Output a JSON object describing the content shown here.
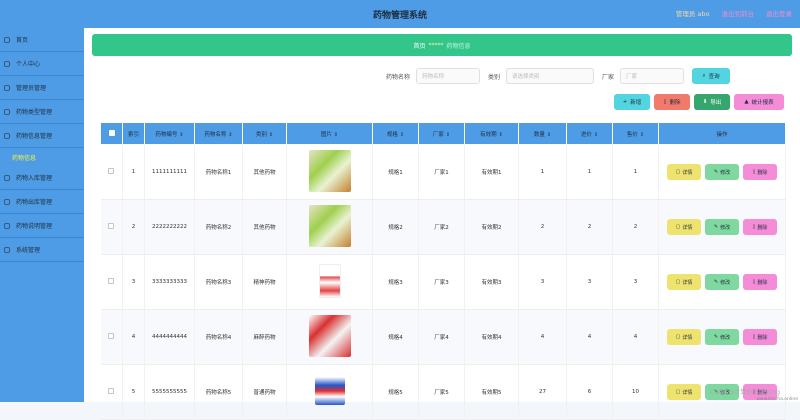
{
  "header": {
    "title": "药物管理系统",
    "admin": "管理员 abo",
    "exit_label": "退出到前台",
    "logout_label": "退出登录"
  },
  "sidebar": {
    "items": [
      {
        "label": "首页"
      },
      {
        "label": "个人中心"
      },
      {
        "label": "管理员管理"
      },
      {
        "label": "药物类型管理"
      },
      {
        "label": "药物信息管理"
      },
      {
        "label": "药物信息",
        "sub": true
      },
      {
        "label": "药物入库管理"
      },
      {
        "label": "药物出库管理"
      },
      {
        "label": "药物说明管理"
      },
      {
        "label": "系统管理"
      }
    ]
  },
  "breadcrumb": {
    "home": "首页",
    "sep": "*****",
    "current": "药物信息"
  },
  "filters": {
    "name_label": "药物名称",
    "name_placeholder": "药物名称",
    "type_label": "类别",
    "type_placeholder": "请选择类别",
    "maker_label": "厂家",
    "maker_placeholder": "厂家",
    "search_label": "查询"
  },
  "toolbar": {
    "add": "新增",
    "delete": "删除",
    "export": "导出",
    "stats": "统计报表"
  },
  "table": {
    "headers": [
      "索引",
      "药物编号",
      "药物名称",
      "类别",
      "图片",
      "规格",
      "厂家",
      "有效期",
      "数量",
      "进价",
      "售价",
      "操作"
    ],
    "rows": [
      {
        "index": "1",
        "code": "1111111111",
        "name": "药物名称1",
        "type": "其他药物",
        "spec": "规格1",
        "maker": "厂家1",
        "expiry": "有效期1",
        "qty": "1",
        "cost": "1",
        "price": "1",
        "img": "green"
      },
      {
        "index": "2",
        "code": "2222222222",
        "name": "药物名称2",
        "type": "其他药物",
        "spec": "规格2",
        "maker": "厂家2",
        "expiry": "有效期2",
        "qty": "2",
        "cost": "2",
        "price": "2",
        "img": "green"
      },
      {
        "index": "3",
        "code": "3333333333",
        "name": "药物名称3",
        "type": "精神药物",
        "spec": "规格3",
        "maker": "厂家3",
        "expiry": "有效期3",
        "qty": "3",
        "cost": "3",
        "price": "3",
        "img": "white"
      },
      {
        "index": "4",
        "code": "4444444444",
        "name": "药物名称4",
        "type": "麻醉药物",
        "spec": "规格4",
        "maker": "厂家4",
        "expiry": "有效期4",
        "qty": "4",
        "cost": "4",
        "price": "4",
        "img": "red"
      },
      {
        "index": "5",
        "code": "5555555555",
        "name": "药物名称5",
        "type": "普通药物",
        "spec": "规格5",
        "maker": "厂家5",
        "expiry": "有效期5",
        "qty": "27",
        "cost": "6",
        "price": "10",
        "img": "blue"
      }
    ],
    "op_labels": {
      "detail": "详情",
      "edit": "修改",
      "delete": "删除"
    }
  },
  "watermark": "CSDN @计算机毕设Sting",
  "watermark2": "www.kiasha.online"
}
